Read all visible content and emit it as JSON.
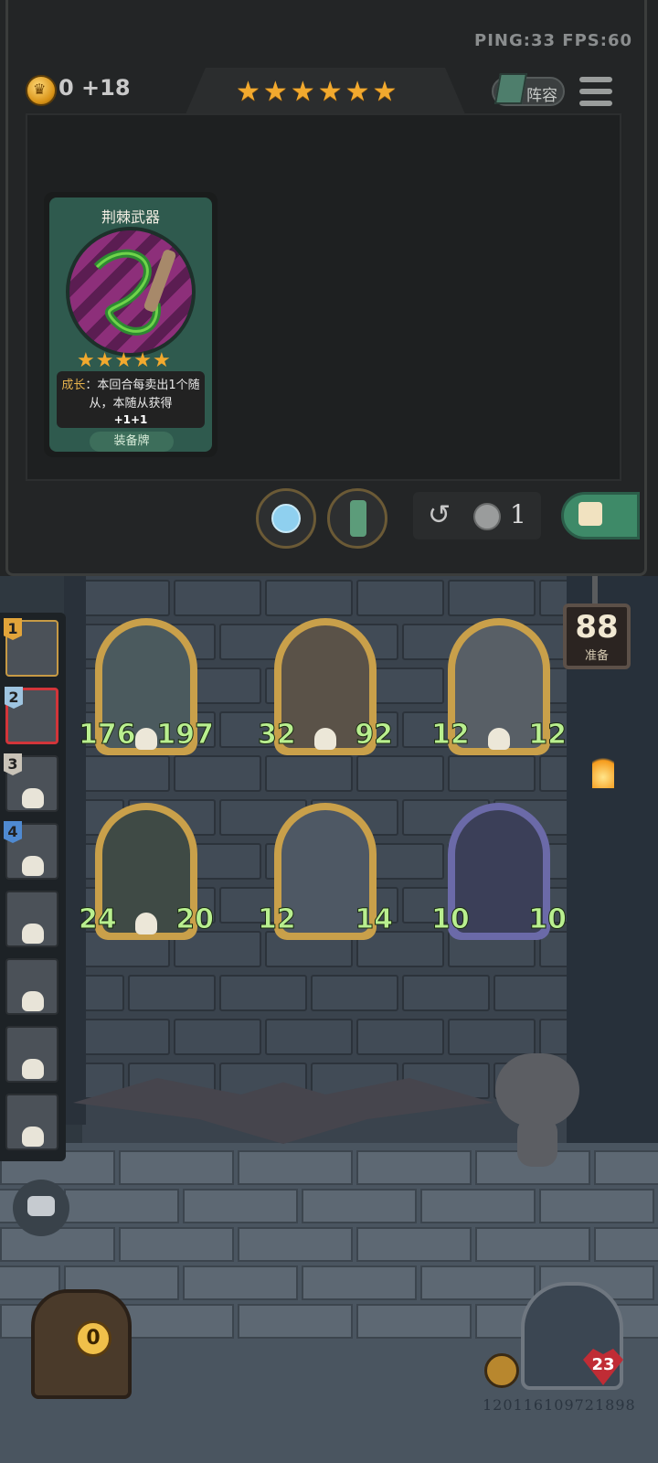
{
  "hud": {
    "ping_fps": "PING:33   FPS:60",
    "gold": "0 +18",
    "tier_stars": 6,
    "lineup_label": "阵容"
  },
  "shop_card": {
    "name": "荆棘武器",
    "stars": 5,
    "keyword": "成长",
    "description": "：本回合每卖出1个随从，本随从获得",
    "bonus": "+1+1",
    "type": "装备牌"
  },
  "shop_controls": {
    "refresh_cost": "1"
  },
  "turn": {
    "value": "88",
    "label": "准备"
  },
  "side_list": [
    {
      "rank": "1",
      "badge_color": "#e2a43a"
    },
    {
      "rank": "2",
      "badge_color": "#9ec4e0"
    },
    {
      "rank": "3",
      "badge_color": "#c9c3b8"
    },
    {
      "rank": "4",
      "badge_color": "#4f8ad1"
    },
    {
      "rank": "",
      "badge_color": ""
    },
    {
      "rank": "",
      "badge_color": ""
    },
    {
      "rank": "",
      "badge_color": ""
    },
    {
      "rank": "",
      "badge_color": ""
    }
  ],
  "minions": [
    {
      "attack": "176",
      "health": "197",
      "frame_color": "#c9a04a",
      "art_color": "#4b5a5e"
    },
    {
      "attack": "32",
      "health": "92",
      "frame_color": "#c9a04a",
      "art_color": "#5a5248"
    },
    {
      "attack": "12",
      "health": "12",
      "frame_color": "#c9a04a",
      "art_color": "#585f66"
    },
    {
      "attack": "24",
      "health": "20",
      "frame_color": "#c9a04a",
      "art_color": "#3f4a45"
    },
    {
      "attack": "12",
      "health": "14",
      "frame_color": "#c9a04a",
      "art_color": "#4e5864"
    },
    {
      "attack": "10",
      "health": "10",
      "frame_color": "#6b6aa8",
      "art_color": "#3b3f58"
    }
  ],
  "bottom": {
    "chest_count": "0",
    "hero_health": "23",
    "player_id": "120116109721898"
  }
}
